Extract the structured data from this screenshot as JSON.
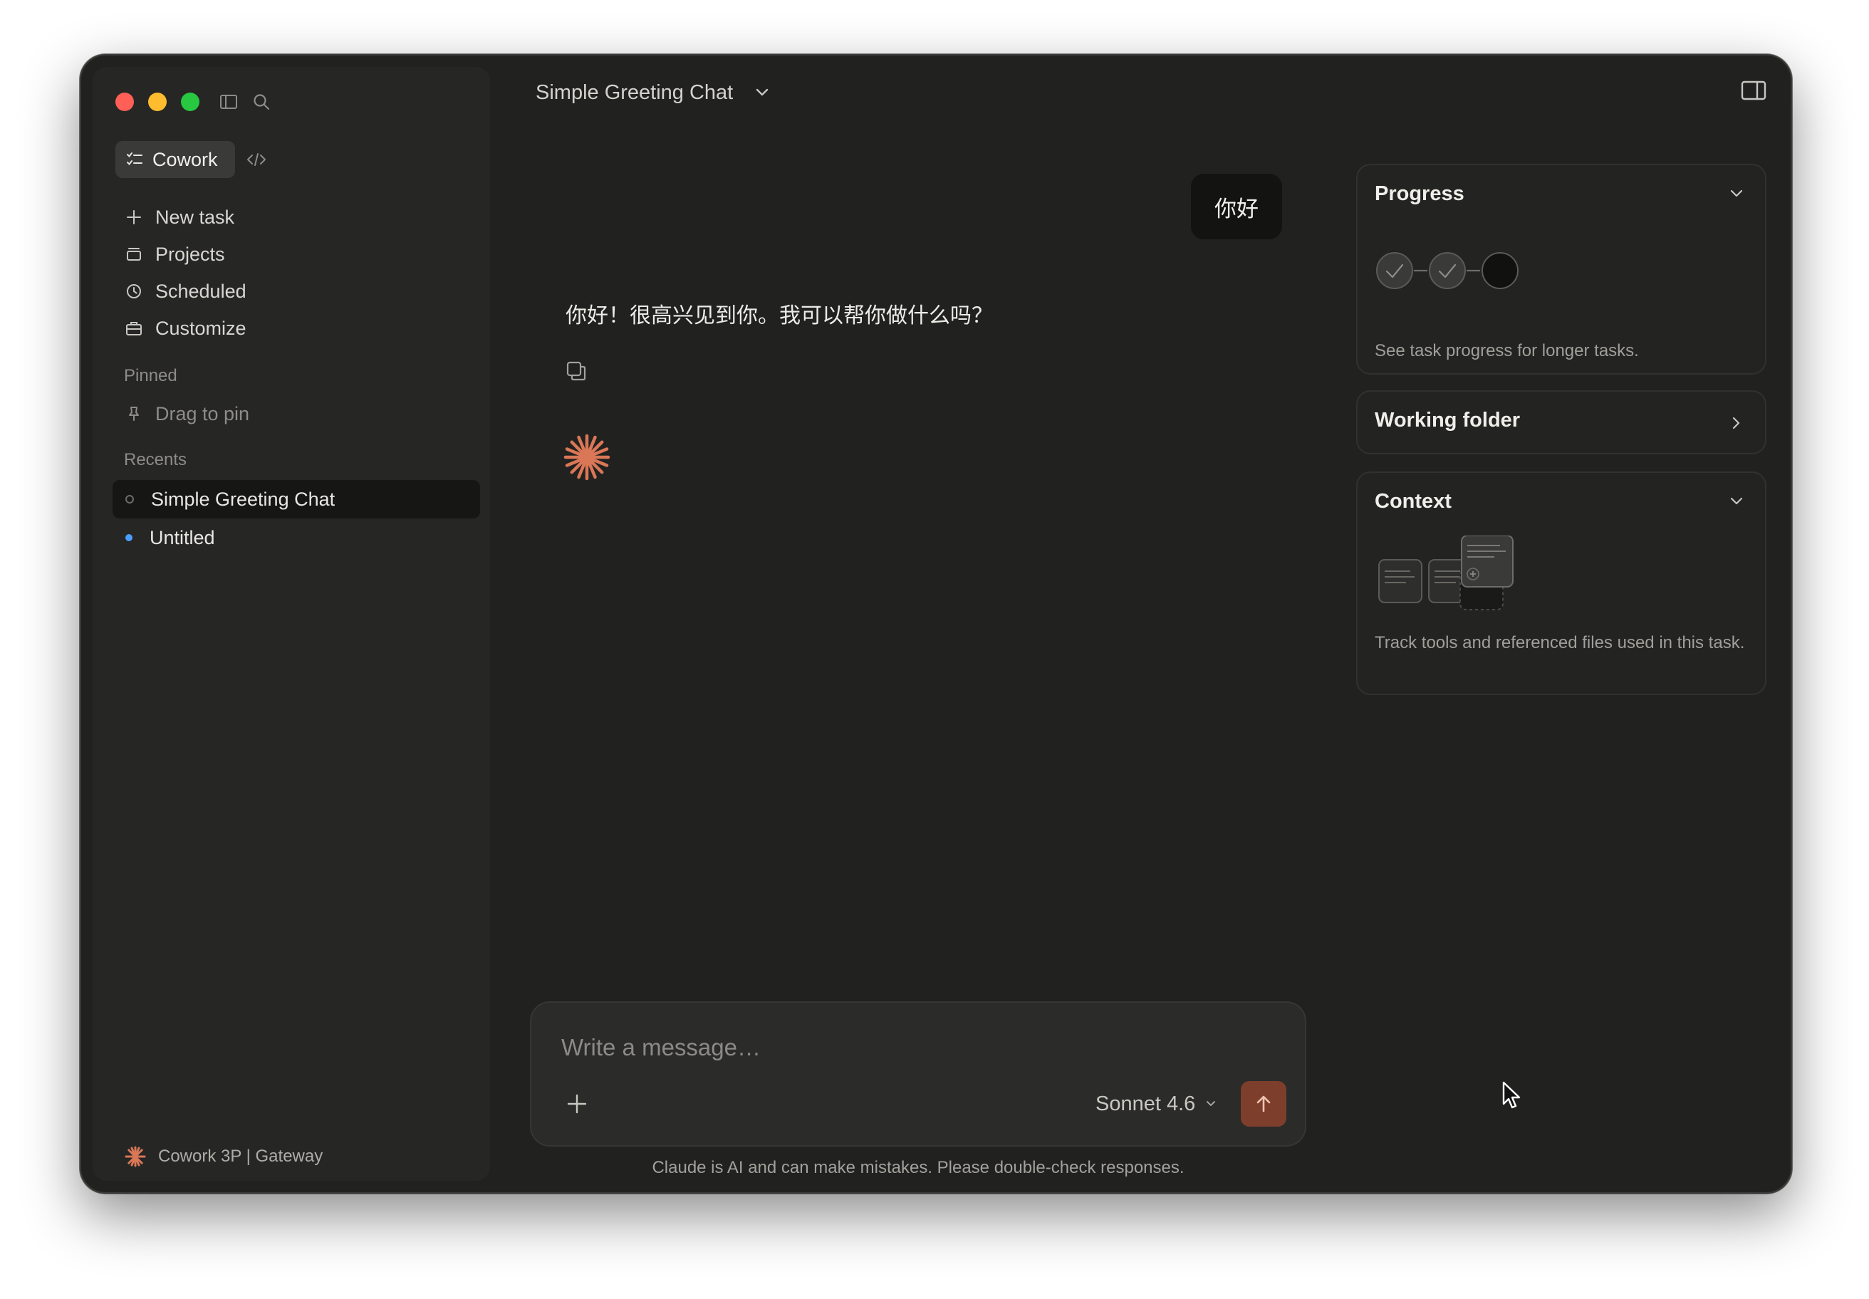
{
  "sidebar": {
    "mode_label": "Cowork",
    "nav": [
      {
        "label": "New task",
        "icon": "plus-icon"
      },
      {
        "label": "Projects",
        "icon": "folder-icon"
      },
      {
        "label": "Scheduled",
        "icon": "clock-icon"
      },
      {
        "label": "Customize",
        "icon": "briefcase-icon"
      }
    ],
    "pinned_label": "Pinned",
    "drag_to_pin": "Drag to pin",
    "recents_label": "Recents",
    "recents": [
      {
        "label": "Simple Greeting Chat",
        "active": true
      },
      {
        "label": "Untitled",
        "active": false,
        "dot_color": "#4a9eff"
      }
    ],
    "footer": "Cowork 3P | Gateway"
  },
  "header": {
    "title": "Simple Greeting Chat"
  },
  "chat": {
    "user_message": "你好",
    "assistant_message": "你好！很高兴见到你。我可以帮你做什么吗？"
  },
  "composer": {
    "placeholder": "Write a message…",
    "model": "Sonnet 4.6",
    "disclaimer": "Claude is AI and can make mistakes. Please double-check responses."
  },
  "panel": {
    "progress": {
      "title": "Progress",
      "description": "See task progress for longer tasks."
    },
    "working_folder": {
      "title": "Working folder"
    },
    "context": {
      "title": "Context",
      "description": "Track tools and referenced files used in this task."
    }
  },
  "colors": {
    "accent": "#d97757",
    "send_button": "#7d3f2c",
    "window_bg": "#212120",
    "sidebar_bg": "#262625"
  }
}
